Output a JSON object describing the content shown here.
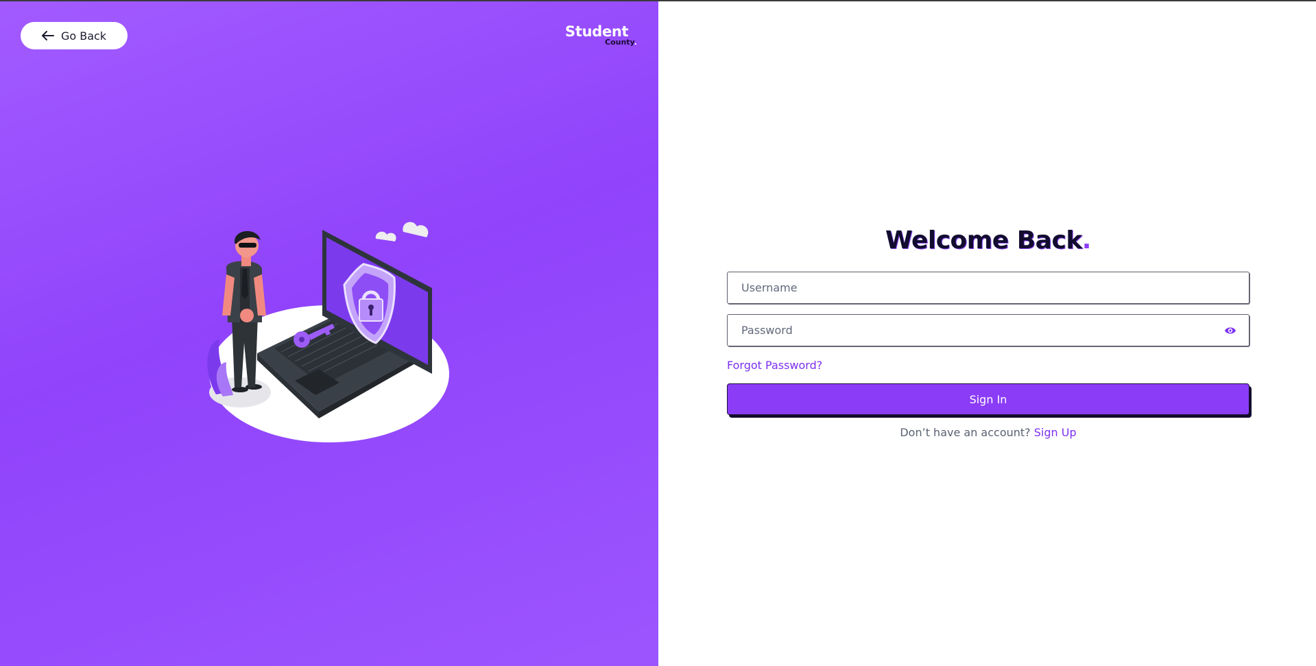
{
  "nav": {
    "go_back_label": "Go Back"
  },
  "brand": {
    "name": "Student",
    "sub": "County",
    "dot": "."
  },
  "illustration": {
    "icon": "security-laptop-guard-illustration"
  },
  "form": {
    "title": "Welcome Back",
    "title_dot": ".",
    "username_placeholder": "Username",
    "password_placeholder": "Password",
    "password_toggle_icon": "eye-icon",
    "forgot_label": "Forgot Password?",
    "signin_label": "Sign In",
    "signup_prompt": "Don’t have an account?",
    "signup_label": "Sign Up"
  },
  "colors": {
    "accent": "#8b3cf7",
    "panel_bg": "#9a50fd",
    "heading": "#120c2e"
  }
}
